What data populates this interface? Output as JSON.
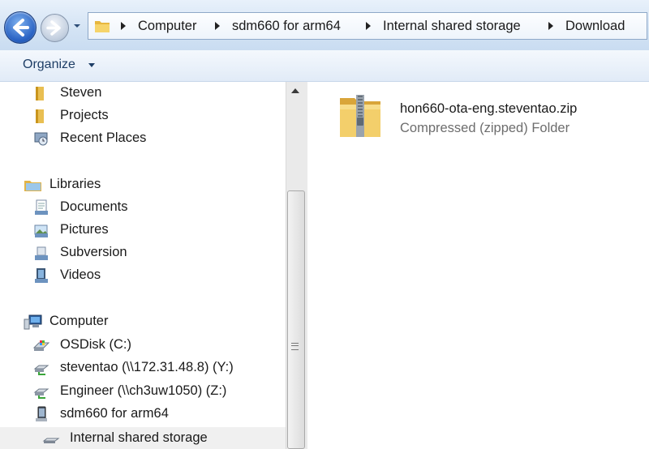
{
  "address_bar": {
    "breadcrumbs": [
      "Computer",
      "sdm660 for arm64",
      "Internal shared storage",
      "Download"
    ]
  },
  "toolbar": {
    "organize_label": "Organize"
  },
  "nav_pane": {
    "favorites": [
      {
        "label": "Steven",
        "icon": "folder-icon"
      },
      {
        "label": "Projects",
        "icon": "folder-icon"
      },
      {
        "label": "Recent Places",
        "icon": "recent-places-icon"
      }
    ],
    "libraries": {
      "label": "Libraries",
      "items": [
        {
          "label": "Documents",
          "icon": "documents-icon"
        },
        {
          "label": "Pictures",
          "icon": "pictures-icon"
        },
        {
          "label": "Subversion",
          "icon": "subversion-icon"
        },
        {
          "label": "Videos",
          "icon": "videos-icon"
        }
      ]
    },
    "computer": {
      "label": "Computer",
      "items": [
        {
          "label": "OSDisk (C:)",
          "icon": "os-disk-icon"
        },
        {
          "label": "steventao (\\\\172.31.48.8) (Y:)",
          "icon": "network-drive-icon"
        },
        {
          "label": "Engineer (\\\\ch3uw1050) (Z:)",
          "icon": "network-drive-icon"
        },
        {
          "label": "sdm660 for arm64",
          "icon": "portable-device-icon"
        },
        {
          "label": "Internal shared storage",
          "icon": "storage-icon"
        }
      ]
    }
  },
  "files": [
    {
      "name": "hon660-ota-eng.steventao.zip",
      "type": "Compressed (zipped) Folder",
      "icon": "zip-folder-icon"
    }
  ],
  "colors": {
    "toolbar_text": "#1e3e66",
    "secondary_text": "#6d6d6d",
    "title_bar": "#d3e3f4"
  }
}
